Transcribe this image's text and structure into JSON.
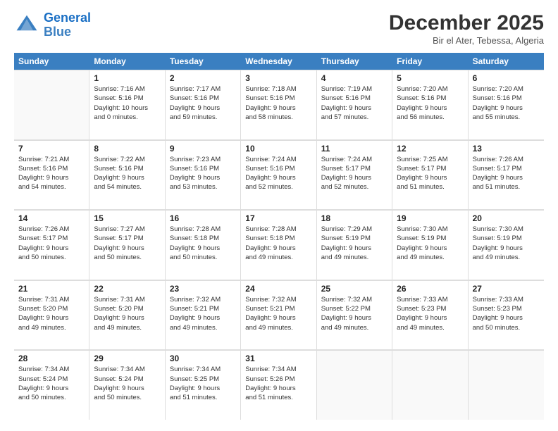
{
  "logo": {
    "line1": "General",
    "line2": "Blue"
  },
  "title": "December 2025",
  "location": "Bir el Ater, Tebessa, Algeria",
  "days_of_week": [
    "Sunday",
    "Monday",
    "Tuesday",
    "Wednesday",
    "Thursday",
    "Friday",
    "Saturday"
  ],
  "weeks": [
    [
      {
        "day": "",
        "info": ""
      },
      {
        "day": "1",
        "info": "Sunrise: 7:16 AM\nSunset: 5:16 PM\nDaylight: 10 hours\nand 0 minutes."
      },
      {
        "day": "2",
        "info": "Sunrise: 7:17 AM\nSunset: 5:16 PM\nDaylight: 9 hours\nand 59 minutes."
      },
      {
        "day": "3",
        "info": "Sunrise: 7:18 AM\nSunset: 5:16 PM\nDaylight: 9 hours\nand 58 minutes."
      },
      {
        "day": "4",
        "info": "Sunrise: 7:19 AM\nSunset: 5:16 PM\nDaylight: 9 hours\nand 57 minutes."
      },
      {
        "day": "5",
        "info": "Sunrise: 7:20 AM\nSunset: 5:16 PM\nDaylight: 9 hours\nand 56 minutes."
      },
      {
        "day": "6",
        "info": "Sunrise: 7:20 AM\nSunset: 5:16 PM\nDaylight: 9 hours\nand 55 minutes."
      }
    ],
    [
      {
        "day": "7",
        "info": "Sunrise: 7:21 AM\nSunset: 5:16 PM\nDaylight: 9 hours\nand 54 minutes."
      },
      {
        "day": "8",
        "info": "Sunrise: 7:22 AM\nSunset: 5:16 PM\nDaylight: 9 hours\nand 54 minutes."
      },
      {
        "day": "9",
        "info": "Sunrise: 7:23 AM\nSunset: 5:16 PM\nDaylight: 9 hours\nand 53 minutes."
      },
      {
        "day": "10",
        "info": "Sunrise: 7:24 AM\nSunset: 5:16 PM\nDaylight: 9 hours\nand 52 minutes."
      },
      {
        "day": "11",
        "info": "Sunrise: 7:24 AM\nSunset: 5:17 PM\nDaylight: 9 hours\nand 52 minutes."
      },
      {
        "day": "12",
        "info": "Sunrise: 7:25 AM\nSunset: 5:17 PM\nDaylight: 9 hours\nand 51 minutes."
      },
      {
        "day": "13",
        "info": "Sunrise: 7:26 AM\nSunset: 5:17 PM\nDaylight: 9 hours\nand 51 minutes."
      }
    ],
    [
      {
        "day": "14",
        "info": "Sunrise: 7:26 AM\nSunset: 5:17 PM\nDaylight: 9 hours\nand 50 minutes."
      },
      {
        "day": "15",
        "info": "Sunrise: 7:27 AM\nSunset: 5:17 PM\nDaylight: 9 hours\nand 50 minutes."
      },
      {
        "day": "16",
        "info": "Sunrise: 7:28 AM\nSunset: 5:18 PM\nDaylight: 9 hours\nand 50 minutes."
      },
      {
        "day": "17",
        "info": "Sunrise: 7:28 AM\nSunset: 5:18 PM\nDaylight: 9 hours\nand 49 minutes."
      },
      {
        "day": "18",
        "info": "Sunrise: 7:29 AM\nSunset: 5:19 PM\nDaylight: 9 hours\nand 49 minutes."
      },
      {
        "day": "19",
        "info": "Sunrise: 7:30 AM\nSunset: 5:19 PM\nDaylight: 9 hours\nand 49 minutes."
      },
      {
        "day": "20",
        "info": "Sunrise: 7:30 AM\nSunset: 5:19 PM\nDaylight: 9 hours\nand 49 minutes."
      }
    ],
    [
      {
        "day": "21",
        "info": "Sunrise: 7:31 AM\nSunset: 5:20 PM\nDaylight: 9 hours\nand 49 minutes."
      },
      {
        "day": "22",
        "info": "Sunrise: 7:31 AM\nSunset: 5:20 PM\nDaylight: 9 hours\nand 49 minutes."
      },
      {
        "day": "23",
        "info": "Sunrise: 7:32 AM\nSunset: 5:21 PM\nDaylight: 9 hours\nand 49 minutes."
      },
      {
        "day": "24",
        "info": "Sunrise: 7:32 AM\nSunset: 5:21 PM\nDaylight: 9 hours\nand 49 minutes."
      },
      {
        "day": "25",
        "info": "Sunrise: 7:32 AM\nSunset: 5:22 PM\nDaylight: 9 hours\nand 49 minutes."
      },
      {
        "day": "26",
        "info": "Sunrise: 7:33 AM\nSunset: 5:23 PM\nDaylight: 9 hours\nand 49 minutes."
      },
      {
        "day": "27",
        "info": "Sunrise: 7:33 AM\nSunset: 5:23 PM\nDaylight: 9 hours\nand 50 minutes."
      }
    ],
    [
      {
        "day": "28",
        "info": "Sunrise: 7:34 AM\nSunset: 5:24 PM\nDaylight: 9 hours\nand 50 minutes."
      },
      {
        "day": "29",
        "info": "Sunrise: 7:34 AM\nSunset: 5:24 PM\nDaylight: 9 hours\nand 50 minutes."
      },
      {
        "day": "30",
        "info": "Sunrise: 7:34 AM\nSunset: 5:25 PM\nDaylight: 9 hours\nand 51 minutes."
      },
      {
        "day": "31",
        "info": "Sunrise: 7:34 AM\nSunset: 5:26 PM\nDaylight: 9 hours\nand 51 minutes."
      },
      {
        "day": "",
        "info": ""
      },
      {
        "day": "",
        "info": ""
      },
      {
        "day": "",
        "info": ""
      }
    ]
  ]
}
